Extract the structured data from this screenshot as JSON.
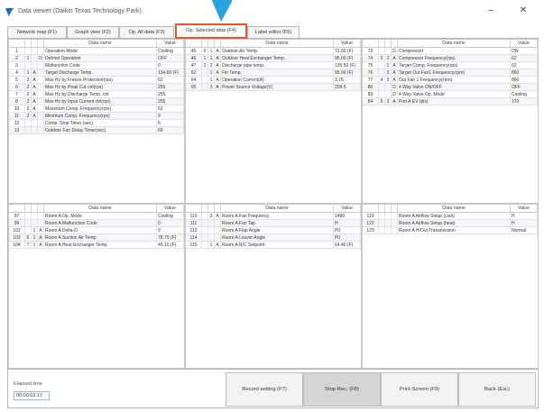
{
  "window": {
    "title": "Data viewer (Daikin Texas Technology Park)"
  },
  "tabs": [
    "Network map (F1)",
    "Graph view (F2)",
    "Op. All data (F3)",
    "Op. Selected data (F4)",
    "Label editor (F5)"
  ],
  "columns": {
    "name": "Data name",
    "value": "Value"
  },
  "panels": [
    {
      "rows": [
        [
          "1",
          "",
          "",
          "",
          "Operation Mode",
          "Cooling"
        ],
        [
          "2",
          "1",
          "",
          "D",
          "Defrost Operation",
          "OFF"
        ],
        [
          "3",
          "",
          "",
          "",
          "Malfunction Code",
          "0"
        ],
        [
          "4",
          "1",
          "A",
          "",
          "Target Discharge Temp.",
          "134.60 (F)"
        ],
        [
          "5",
          "2",
          "A",
          "",
          "Max Hz by Freeze Protection(rps)",
          "62"
        ],
        [
          "6",
          "2",
          "A",
          "",
          "Max Hz by Peak Cut ctrl(rps)",
          "255"
        ],
        [
          "7",
          "2",
          "A",
          "",
          "Max Hz by Discharge Temp. ctrl",
          "255"
        ],
        [
          "8",
          "2",
          "A",
          "",
          "Max Hz by Input Current ctrl(rps)",
          "255"
        ],
        [
          "10",
          "2",
          "A",
          "",
          "Maximum Comp. Frequency(rps)",
          "62"
        ],
        [
          "11",
          "2",
          "A",
          "",
          "Minimum Comp. Frequency(rps)",
          "9"
        ],
        [
          "12",
          "",
          "",
          "",
          "Comp. Stop Timer (sec)",
          "8"
        ],
        [
          "13",
          "",
          "",
          "",
          "Outdoor Fan Delay Timer(sec)",
          "60"
        ]
      ]
    },
    {
      "rows": [
        [
          "45",
          "0",
          "1",
          "A",
          "Outdoor Air Temp.",
          "71.60 (F)"
        ],
        [
          "46",
          "1",
          "1",
          "A",
          "Outdoor Heat Exchanger Temp.",
          "95.00 (F)"
        ],
        [
          "47",
          "2",
          "2",
          "A",
          "Discharge pipe temp.",
          "135.50 (F)"
        ],
        [
          "62",
          "",
          "1",
          "A",
          "Fin Temp.",
          "95.00 (F)"
        ],
        [
          "64",
          "",
          "1",
          "A",
          "Operation Current(A)",
          "3.75"
        ],
        [
          "65",
          "",
          "3",
          "A",
          "Power Source Voltage(V)",
          "209.5"
        ]
      ]
    },
    {
      "rows": [
        [
          "73",
          "",
          "",
          "D",
          "Compressor",
          "ON"
        ],
        [
          "74",
          "3",
          "2",
          "A",
          "Compressor Frequency(rps)",
          "62"
        ],
        [
          "75",
          "",
          "2",
          "A",
          "Target Comp. Frequency(rps)",
          "62"
        ],
        [
          "76",
          "",
          "3",
          "A",
          "Target Out Fan1 Frequency(rpm)",
          "860"
        ],
        [
          "77",
          "4",
          "3",
          "A",
          "Out Fan 1 Frequency(rpm)",
          "860"
        ],
        [
          "80",
          "",
          "",
          "D",
          "4 Way Valve ON/OFF",
          "OFF"
        ],
        [
          "83",
          "",
          "",
          "D",
          "4 Way Valve Op. Mode",
          "Cooling"
        ],
        [
          "84",
          "5",
          "3",
          "A",
          "Port A EV (pls)",
          "170"
        ]
      ]
    },
    {
      "rows": [
        [
          "97",
          "",
          "",
          "",
          "Room A Op. Mode",
          "Cooling"
        ],
        [
          "99",
          "",
          "",
          "",
          "Room A Malfunction Code",
          "0"
        ],
        [
          "102",
          "",
          "1",
          "A",
          "Room A Delta-D",
          "9"
        ],
        [
          "103",
          "6",
          "1",
          "A",
          "Room A Suction Air Temp.",
          "78.70 (F)"
        ],
        [
          "104",
          "7",
          "1",
          "A",
          "Room A Heat Exchanger Temp.",
          "49.10 (F)"
        ]
      ]
    },
    {
      "rows": [
        [
          "110",
          "",
          "3",
          "A",
          "Room A Fan Frequency",
          "1480"
        ],
        [
          "111",
          "",
          "",
          "",
          "Room A Fan Tap",
          "H"
        ],
        [
          "113",
          "",
          "",
          "",
          "Room A Flap Angle",
          "P0"
        ],
        [
          "114",
          "",
          "",
          "",
          "Room A Louver Angle",
          "P0"
        ],
        [
          "115",
          "",
          "1",
          "A",
          "Room A R/C Setpoint",
          "64.40 (F)"
        ]
      ]
    },
    {
      "rows": [
        [
          "119",
          "",
          "",
          "",
          "Room A Airflow Setup (cool)",
          "H"
        ],
        [
          "122",
          "",
          "",
          "",
          "Room A Airflow Setup (heat)",
          "H"
        ],
        [
          "123",
          "",
          "",
          "",
          "Room A H/Out Transmission",
          "Normal"
        ]
      ]
    }
  ],
  "footer": {
    "elapsed_label": "Elapsed time",
    "elapsed_value": "00:00:02:17",
    "buttons": [
      "Record setting (F7)",
      "Stop Rec. (F8)",
      "Print Screen (F9)",
      "Back (Esc)"
    ]
  },
  "colors": {
    "active_tab_border": "#e4572a",
    "arrow": "#29a3e0"
  }
}
